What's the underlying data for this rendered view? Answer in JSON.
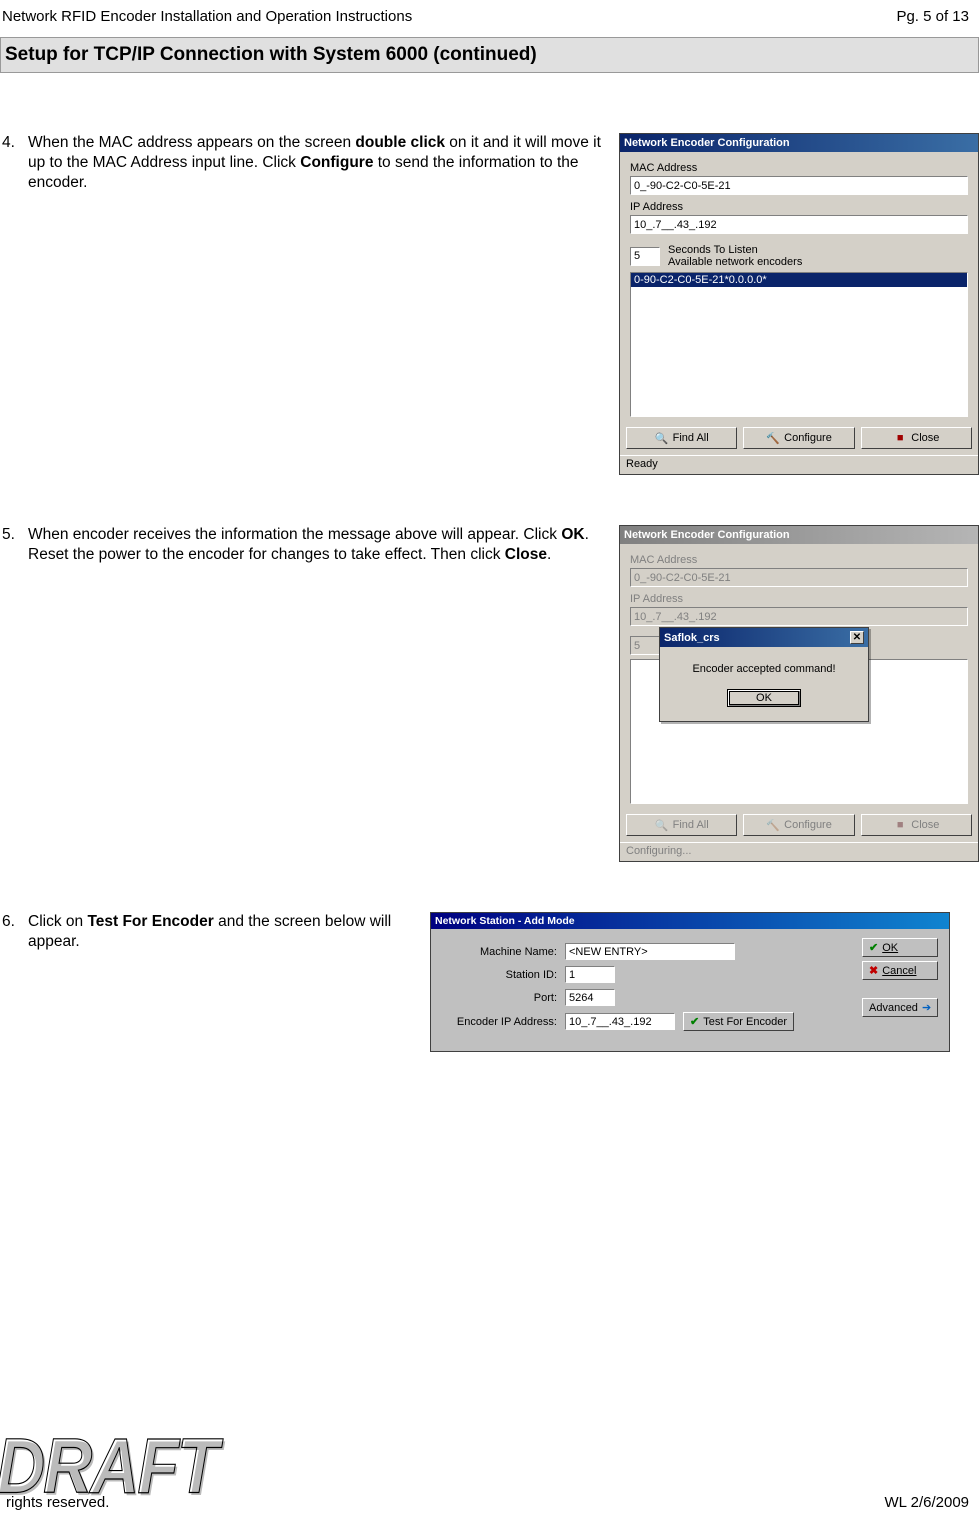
{
  "header": {
    "doc_title": "Network RFID Encoder Installation and Operation Instructions",
    "page": "Pg. 5 of 13"
  },
  "section_heading": "Setup for TCP/IP Connection with System 6000 (continued)",
  "steps": {
    "s4": {
      "num": "4.",
      "part1": "When the MAC address appears on the screen ",
      "bold1": "double click",
      "part2": " on it and it will move it up to the MAC Address input line. Click ",
      "bold2": "Configure",
      "part3": " to send the information to the encoder."
    },
    "s5": {
      "num": "5.",
      "part1": "When encoder receives the information the message above will appear. Click ",
      "bold1": "OK",
      "part2": ". Reset the power to the encoder for changes to take effect. Then click ",
      "bold2": "Close",
      "part3": "."
    },
    "s6": {
      "num": "6.",
      "part1": "Click on ",
      "bold1": "Test For Encoder",
      "part2": " and the screen below will appear."
    }
  },
  "dialog1": {
    "title": "Network Encoder Configuration",
    "mac_label": "MAC Address",
    "mac_value": "0_-90-C2-C0-5E-21",
    "ip_label": "IP Address",
    "ip_value": "10_.7__.43_.192",
    "seconds_value": "5",
    "seconds_label": "Seconds To Listen",
    "available_label": "Available network encoders",
    "list_item": "0-90-C2-C0-5E-21*0.0.0.0*",
    "btn_find": "Find All",
    "btn_configure": "Configure",
    "btn_close": "Close",
    "status": "Ready"
  },
  "dialog2": {
    "title": "Network Encoder Configuration",
    "mac_label": "MAC Address",
    "mac_value": "0_-90-C2-C0-5E-21",
    "ip_label": "IP Address",
    "ip_value": "10_.7__.43_.192",
    "seconds_value": "5",
    "btn_find": "Find All",
    "btn_configure": "Configure",
    "btn_close": "Close",
    "status": "Configuring...",
    "msg_title": "Saflok_crs",
    "msg_text": "Encoder accepted command!",
    "msg_ok": "OK"
  },
  "dialog3": {
    "title": "Network Station - Add Mode",
    "machine_lbl": "Machine Name:",
    "machine_val": "<NEW ENTRY>",
    "station_lbl": "Station ID:",
    "station_val": "1",
    "port_lbl": "Port:",
    "port_val": "5264",
    "ip_lbl": "Encoder IP Address:",
    "ip_val": "10_.7__.43_.192",
    "test_btn": "Test For Encoder",
    "ok_btn": "OK",
    "cancel_btn": "Cancel",
    "advanced_btn": "Advanced"
  },
  "footer": {
    "copyright_fragment": "rights reserved.",
    "date": "WL 2/6/2009",
    "draft": "DRAFT"
  }
}
